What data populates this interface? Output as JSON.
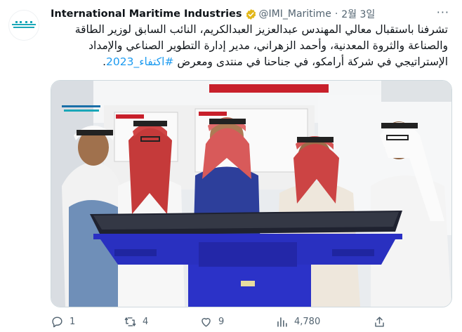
{
  "tweet": {
    "author_name": "International Maritime Industries",
    "handle": "@IMI_Maritime",
    "separator": "·",
    "date": "2월 3일",
    "more": "···",
    "text_main": "تشرفنا باستقبال معالي المهندس عبدالعزيز العبدالكريم، النائب السابق لوزير الطاقة والصناعة والثروة المعدنية، وأحمد الزهراني، مدير إدارة التطوير الصناعي والإمداد الإستراتيجي في شركة أرامكو، في جناحنا في منتدى ومعرض ",
    "hashtag": "#اكتفاء_2023",
    "text_end": "."
  },
  "actions": {
    "replies": "1",
    "retweets": "4",
    "likes": "9",
    "views": "4,780"
  },
  "colors": {
    "accent": "#1d9bf0",
    "verified_gold": "#e2b719",
    "muted": "#536471"
  },
  "icons": [
    "reply-icon",
    "retweet-icon",
    "like-icon",
    "views-icon",
    "share-icon",
    "verified-badge-icon",
    "more-icon"
  ]
}
